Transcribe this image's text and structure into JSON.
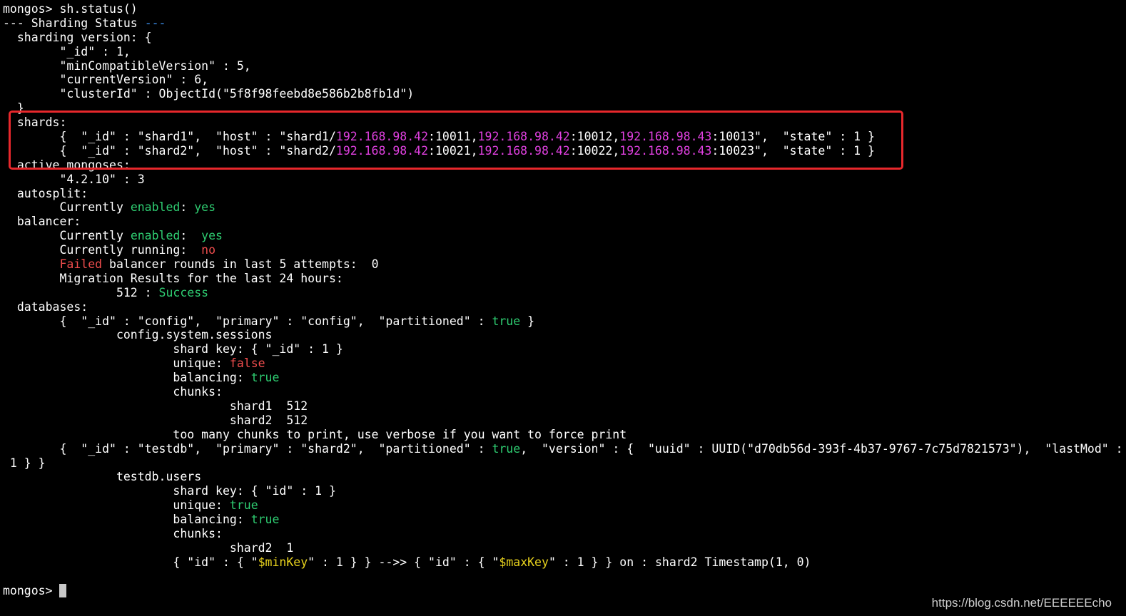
{
  "terminal": {
    "lines": [
      {
        "segments": [
          {
            "text": "mongos> sh.status()",
            "color": "white"
          }
        ]
      },
      {
        "segments": [
          {
            "text": "--- Sharding Status ",
            "color": "white"
          },
          {
            "text": "---",
            "color": "blue"
          }
        ]
      },
      {
        "segments": [
          {
            "text": "  sharding version: {",
            "color": "white"
          }
        ]
      },
      {
        "segments": [
          {
            "text": "        \"_id\" : 1,",
            "color": "white"
          }
        ]
      },
      {
        "segments": [
          {
            "text": "        \"minCompatibleVersion\" : 5,",
            "color": "white"
          }
        ]
      },
      {
        "segments": [
          {
            "text": "        \"currentVersion\" : 6,",
            "color": "white"
          }
        ]
      },
      {
        "segments": [
          {
            "text": "        \"clusterId\" : ObjectId(\"5f8f98feebd8e586b2b8fb1d\")",
            "color": "white"
          }
        ]
      },
      {
        "segments": [
          {
            "text": "  }",
            "color": "white"
          }
        ]
      },
      {
        "segments": [
          {
            "text": "  shards:",
            "color": "white"
          }
        ]
      },
      {
        "segments": [
          {
            "text": "        {  \"_id\" : \"shard1\",  \"host\" : \"shard1/",
            "color": "white"
          },
          {
            "text": "192.168.98.42",
            "color": "magenta"
          },
          {
            "text": ":10011,",
            "color": "white"
          },
          {
            "text": "192.168.98.42",
            "color": "magenta"
          },
          {
            "text": ":10012,",
            "color": "white"
          },
          {
            "text": "192.168.98.43",
            "color": "magenta"
          },
          {
            "text": ":10013\",  \"state\" : 1 }",
            "color": "white"
          }
        ]
      },
      {
        "segments": [
          {
            "text": "        {  \"_id\" : \"shard2\",  \"host\" : \"shard2/",
            "color": "white"
          },
          {
            "text": "192.168.98.42",
            "color": "magenta"
          },
          {
            "text": ":10021,",
            "color": "white"
          },
          {
            "text": "192.168.98.42",
            "color": "magenta"
          },
          {
            "text": ":10022,",
            "color": "white"
          },
          {
            "text": "192.168.98.43",
            "color": "magenta"
          },
          {
            "text": ":10023\",  \"state\" : 1 }",
            "color": "white"
          }
        ]
      },
      {
        "segments": [
          {
            "text": "  active mongoses:",
            "color": "white"
          }
        ]
      },
      {
        "segments": [
          {
            "text": "        \"4.2.10\" : 3",
            "color": "white"
          }
        ]
      },
      {
        "segments": [
          {
            "text": "  autosplit:",
            "color": "white"
          }
        ]
      },
      {
        "segments": [
          {
            "text": "        Currently ",
            "color": "white"
          },
          {
            "text": "enabled",
            "color": "green"
          },
          {
            "text": ": ",
            "color": "white"
          },
          {
            "text": "yes",
            "color": "green"
          }
        ]
      },
      {
        "segments": [
          {
            "text": "  balancer:",
            "color": "white"
          }
        ]
      },
      {
        "segments": [
          {
            "text": "        Currently ",
            "color": "white"
          },
          {
            "text": "enabled",
            "color": "green"
          },
          {
            "text": ":  ",
            "color": "white"
          },
          {
            "text": "yes",
            "color": "green"
          }
        ]
      },
      {
        "segments": [
          {
            "text": "        Currently running:  ",
            "color": "white"
          },
          {
            "text": "no",
            "color": "red"
          }
        ]
      },
      {
        "segments": [
          {
            "text": "        ",
            "color": "white"
          },
          {
            "text": "Failed",
            "color": "red"
          },
          {
            "text": " balancer rounds in last 5 attempts:  0",
            "color": "white"
          }
        ]
      },
      {
        "segments": [
          {
            "text": "        Migration Results for the last 24 hours:",
            "color": "white"
          }
        ]
      },
      {
        "segments": [
          {
            "text": "                512 : ",
            "color": "white"
          },
          {
            "text": "Success",
            "color": "green"
          }
        ]
      },
      {
        "segments": [
          {
            "text": "  databases:",
            "color": "white"
          }
        ]
      },
      {
        "segments": [
          {
            "text": "        {  \"_id\" : \"config\",  \"primary\" : \"config\",  \"partitioned\" : ",
            "color": "white"
          },
          {
            "text": "true",
            "color": "green"
          },
          {
            "text": " }",
            "color": "white"
          }
        ]
      },
      {
        "segments": [
          {
            "text": "                config.system.sessions",
            "color": "white"
          }
        ]
      },
      {
        "segments": [
          {
            "text": "                        shard key: { \"_id\" : 1 }",
            "color": "white"
          }
        ]
      },
      {
        "segments": [
          {
            "text": "                        unique: ",
            "color": "white"
          },
          {
            "text": "false",
            "color": "red"
          }
        ]
      },
      {
        "segments": [
          {
            "text": "                        balancing: ",
            "color": "white"
          },
          {
            "text": "true",
            "color": "green"
          }
        ]
      },
      {
        "segments": [
          {
            "text": "                        chunks:",
            "color": "white"
          }
        ]
      },
      {
        "segments": [
          {
            "text": "                                shard1  512",
            "color": "white"
          }
        ]
      },
      {
        "segments": [
          {
            "text": "                                shard2  512",
            "color": "white"
          }
        ]
      },
      {
        "segments": [
          {
            "text": "                        too many chunks to print, use verbose if you want to force print",
            "color": "white"
          }
        ]
      },
      {
        "segments": [
          {
            "text": "        {  \"_id\" : \"testdb\",  \"primary\" : \"shard2\",  \"partitioned\" : ",
            "color": "white"
          },
          {
            "text": "true",
            "color": "green"
          },
          {
            "text": ",  \"version\" : {  \"uuid\" : UUID(\"d70db56d-393f-4b37-9767-7c75d7821573\"),  \"lastMod\" :",
            "color": "white"
          }
        ]
      },
      {
        "segments": [
          {
            "text": " 1 } }",
            "color": "white"
          }
        ]
      },
      {
        "segments": [
          {
            "text": "                testdb.users",
            "color": "white"
          }
        ]
      },
      {
        "segments": [
          {
            "text": "                        shard key: { \"id\" : 1 }",
            "color": "white"
          }
        ]
      },
      {
        "segments": [
          {
            "text": "                        unique: ",
            "color": "white"
          },
          {
            "text": "true",
            "color": "green"
          }
        ]
      },
      {
        "segments": [
          {
            "text": "                        balancing: ",
            "color": "white"
          },
          {
            "text": "true",
            "color": "green"
          }
        ]
      },
      {
        "segments": [
          {
            "text": "                        chunks:",
            "color": "white"
          }
        ]
      },
      {
        "segments": [
          {
            "text": "                                shard2  1",
            "color": "white"
          }
        ]
      },
      {
        "segments": [
          {
            "text": "                        { \"id\" : { \"",
            "color": "white"
          },
          {
            "text": "$minKey",
            "color": "yellow"
          },
          {
            "text": "\" : 1 } } -->> { \"id\" : { \"",
            "color": "white"
          },
          {
            "text": "$maxKey",
            "color": "yellow"
          },
          {
            "text": "\" : 1 } } on : shard2 Timestamp(1, 0)",
            "color": "white"
          }
        ]
      },
      {
        "segments": [
          {
            "text": "",
            "color": "white"
          }
        ]
      },
      {
        "segments": [
          {
            "text": "mongos> ",
            "color": "white"
          }
        ],
        "cursor": true
      }
    ]
  },
  "watermark": "https://blog.csdn.net/EEEEEEcho",
  "colors": {
    "background": "#000000",
    "text": "#ffffff",
    "green": "#2ecc71",
    "red": "#ef4d4d",
    "magenta": "#e040e0",
    "yellow": "#e8d21d",
    "blue": "#3b8eea",
    "highlight_box": "#e8282c"
  }
}
